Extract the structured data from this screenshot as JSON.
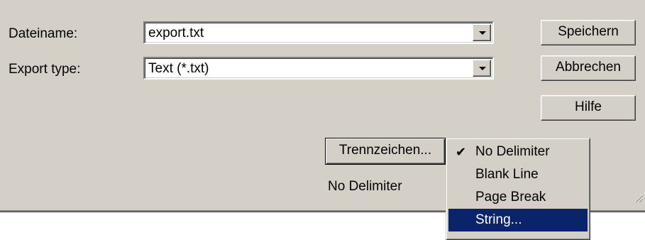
{
  "form": {
    "filename_label": "Dateiname:",
    "filename_value": "export.txt",
    "type_label": "Export type:",
    "type_value": "Text (*.txt)"
  },
  "buttons": {
    "save": "Speichern",
    "cancel": "Abbrechen",
    "help": "Hilfe",
    "delimiter": "Trennzeichen..."
  },
  "delimiter_status": "No Delimiter",
  "menu": {
    "items": [
      {
        "label": "No Delimiter",
        "checked": true
      },
      {
        "label": "Blank Line",
        "checked": false
      },
      {
        "label": "Page Break",
        "checked": false
      },
      {
        "label": "String...",
        "checked": false
      }
    ],
    "selected_index": 3,
    "check_mark": "✔"
  },
  "colors": {
    "dialog_bg": "#d4d0c8",
    "menu_highlight": "#0a246a"
  }
}
